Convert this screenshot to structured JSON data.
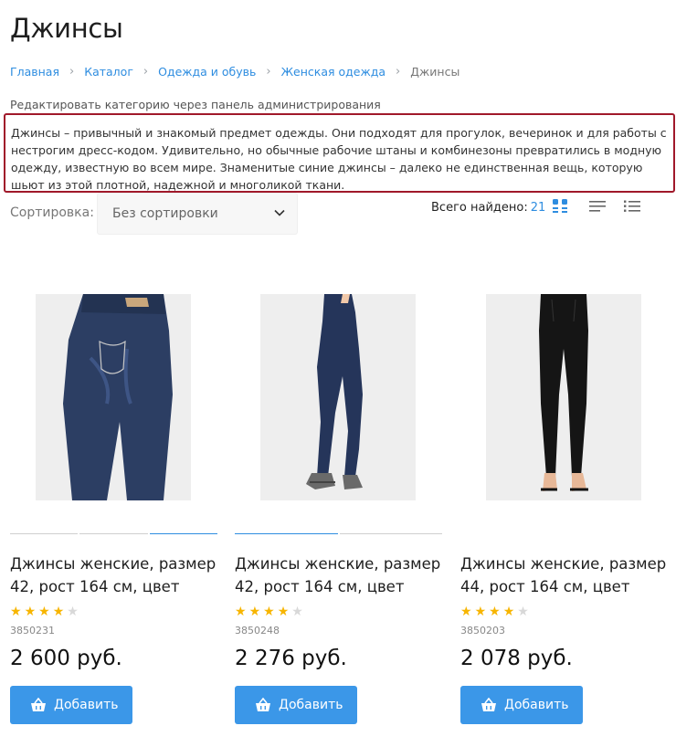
{
  "page": {
    "title": "Джинсы",
    "admin_link": "Редактировать категорию через панель администрирования",
    "description": "Джинсы – привычный и знакомый предмет одежды. Они подходят для прогулок, вечеринок и для работы с нестрогим дресс-кодом. Удивительно, но обычные рабочие штаны и комбинезоны превратились в модную одежду, известную во всем мире. Знаменитые синие джинсы – далеко не единственная вещь, которую шьют из этой плотной, надежной и многоликой ткани."
  },
  "breadcrumb": {
    "items": [
      "Главная",
      "Каталог",
      "Одежда и обувь",
      "Женская одежда"
    ],
    "current": "Джинсы"
  },
  "toolbar": {
    "sort_label": "Сортировка:",
    "sort_value": "Без сортировки",
    "found_label": "Всего найдено:",
    "found_count": "21",
    "views": [
      "grid-view-icon",
      "list-view-icon",
      "detail-list-view-icon"
    ],
    "accent_color": "#2e8de0"
  },
  "products": [
    {
      "name": "Джинсы женские, размер 42, рост 164 см, цвет тёмно-",
      "rating": 4,
      "rating_max": 5,
      "sku": "3850231",
      "price": "2 600 руб.",
      "add_label": "Добавить",
      "thumb_count": 3,
      "active_thumb": 2
    },
    {
      "name": "Джинсы женские, размер 42, рост 164 см, цвет тёмно-",
      "rating": 4,
      "rating_max": 5,
      "sku": "3850248",
      "price": "2 276 руб.",
      "add_label": "Добавить",
      "thumb_count": 2,
      "active_thumb": 0
    },
    {
      "name": "Джинсы женские, размер 44, рост 164 см, цвет чёрный",
      "rating": 4,
      "rating_max": 5,
      "sku": "3850203",
      "price": "2 078 руб.",
      "add_label": "Добавить",
      "thumb_count": 0,
      "active_thumb": -1
    }
  ]
}
